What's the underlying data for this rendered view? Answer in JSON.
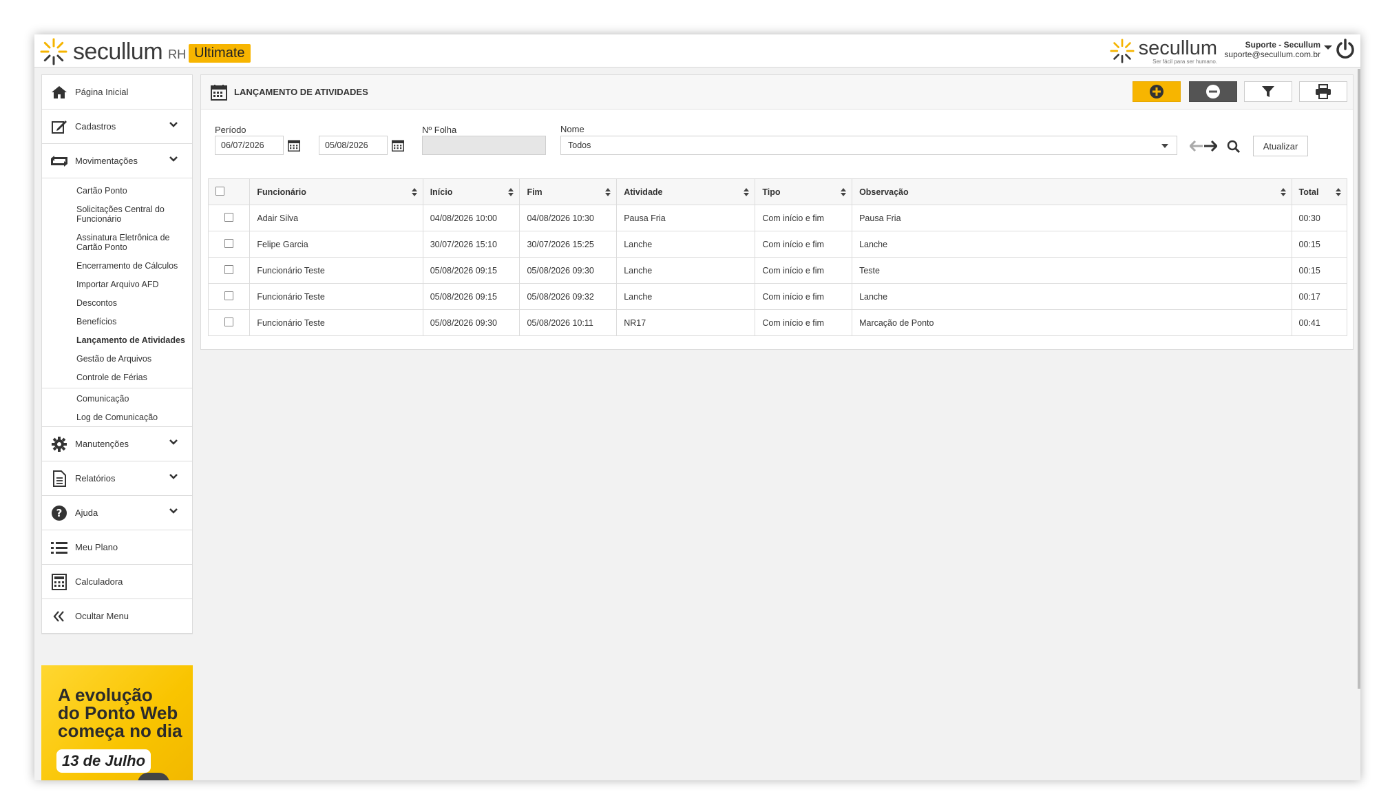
{
  "header": {
    "brand_word": "secullum",
    "brand_rh": "RH",
    "brand_badge": "Ultimate",
    "brand2_word": "secullum",
    "brand2_tag": "Ser fácil para ser humano.",
    "user_name": "Suporte - Secullum",
    "user_email": "suporte@secullum.com.br"
  },
  "sidebar": {
    "items": [
      {
        "label": "Página Inicial",
        "icon": "home-icon"
      },
      {
        "label": "Cadastros",
        "icon": "edit-icon"
      },
      {
        "label": "Movimentações",
        "icon": "swap-icon"
      }
    ],
    "sub_items": [
      "Cartão Ponto",
      "Solicitações Central do Funcionário",
      "Assinatura Eletrônica de Cartão Ponto",
      "Encerramento de Cálculos",
      "Importar Arquivo AFD",
      "Descontos",
      "Benefícios",
      "Lançamento de Atividades",
      "Gestão de Arquivos",
      "Controle de Férias",
      "Comunicação",
      "Log de Comunicação"
    ],
    "items_bottom": [
      {
        "label": "Manutenções",
        "icon": "gear-icon"
      },
      {
        "label": "Relatórios",
        "icon": "document-icon"
      },
      {
        "label": "Ajuda",
        "icon": "help-icon"
      },
      {
        "label": "Meu Plano",
        "icon": "list-icon"
      },
      {
        "label": "Calculadora",
        "icon": "calculator-icon"
      },
      {
        "label": "Ocultar Menu",
        "icon": "double-chevron-left-icon"
      }
    ],
    "promo": {
      "line1": "A evolução",
      "line2": "do Ponto Web",
      "line3": "começa no dia",
      "date": "13 de Julho"
    }
  },
  "panel": {
    "title": "LANÇAMENTO DE ATIVIDADES",
    "filters": {
      "periodo_label": "Período",
      "date_start": "06/07/2026",
      "date_end": "05/08/2026",
      "folha_label": "Nº Folha",
      "folha_value": "",
      "nome_label": "Nome",
      "nome_value": "Todos",
      "update_label": "Atualizar"
    },
    "table": {
      "columns": [
        "Funcionário",
        "Início",
        "Fim",
        "Atividade",
        "Tipo",
        "Observação",
        "Total"
      ],
      "rows": [
        [
          "Adair Silva",
          "04/08/2026 10:00",
          "04/08/2026 10:30",
          "Pausa Fria",
          "Com início e fim",
          "Pausa Fria",
          "00:30"
        ],
        [
          "Felipe Garcia",
          "30/07/2026 15:10",
          "30/07/2026 15:25",
          "Lanche",
          "Com início e fim",
          "Lanche",
          "00:15"
        ],
        [
          "Funcionário Teste",
          "05/08/2026 09:15",
          "05/08/2026 09:30",
          "Lanche",
          "Com início e fim",
          "Teste",
          "00:15"
        ],
        [
          "Funcionário Teste",
          "05/08/2026 09:15",
          "05/08/2026 09:32",
          "Lanche",
          "Com início e fim",
          "Lanche",
          "00:17"
        ],
        [
          "Funcionário Teste",
          "05/08/2026 09:30",
          "05/08/2026 10:11",
          "NR17",
          "Com início e fim",
          "Marcação de Ponto",
          "00:41"
        ]
      ]
    }
  },
  "colors": {
    "accent": "#f7b500",
    "dark_button": "#545454",
    "border": "#dcdcdc"
  }
}
